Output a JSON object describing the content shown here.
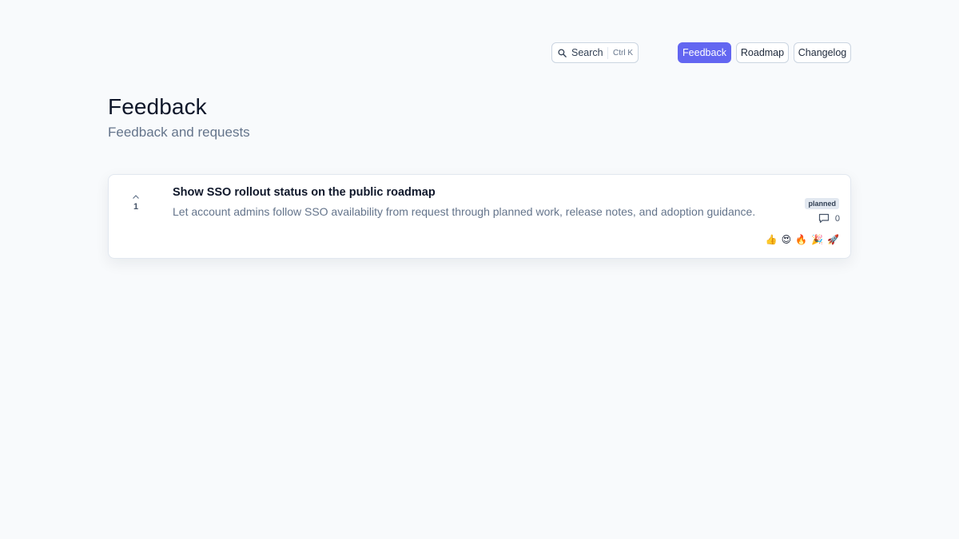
{
  "header": {
    "search": {
      "label": "Search",
      "shortcut": "Ctrl K",
      "icon": "search-icon"
    },
    "nav": [
      {
        "label": "Feedback",
        "active": true
      },
      {
        "label": "Roadmap",
        "active": false
      },
      {
        "label": "Changelog",
        "active": false
      }
    ],
    "accent_color": "#6366f1"
  },
  "page": {
    "title": "Feedback",
    "subtitle": "Feedback and requests"
  },
  "items": [
    {
      "votes": "1",
      "title": "Show SSO rollout status on the public roadmap",
      "description": "Let account admins follow SSO availability from request through planned work, release notes, and adoption guidance.",
      "status": "planned",
      "comment_count": "0",
      "reactions": [
        "👍",
        "😍",
        "🔥",
        "🎉",
        "🚀"
      ]
    }
  ]
}
